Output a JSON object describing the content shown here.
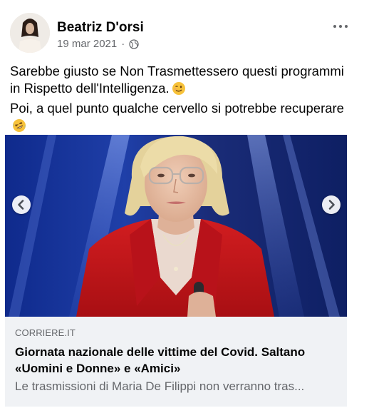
{
  "post": {
    "author": "Beatriz D'orsi",
    "date": "19 mar 2021",
    "separator": "·",
    "privacy_icon": "globe-icon",
    "more_icon": "more-options-icon",
    "text_lines": [
      "Sarebbe giusto se Non Trasmettessero questi programmi in Rispetto dell'Intelligenza.",
      "Poi, a quel punto qualche cervello si potrebbe recuperare"
    ],
    "emojis": [
      "winking-face-emoji",
      "rolling-on-floor-laughing-emoji"
    ]
  },
  "media": {
    "prev_icon": "chevron-left-icon",
    "next_icon": "chevron-right-icon"
  },
  "link_preview": {
    "domain": "CORRIERE.IT",
    "title": "Giornata nazionale delle vittime del Covid. Saltano «Uomini e Donne» e «Amici»",
    "description": "Le trasmissioni di Maria De Filippi non verranno tras..."
  },
  "colors": {
    "text_primary": "#050505",
    "text_secondary": "#65676b",
    "link_background": "#f0f2f5",
    "jacket_red": "#c8171b",
    "stage_blue": "#1b2f7a"
  }
}
